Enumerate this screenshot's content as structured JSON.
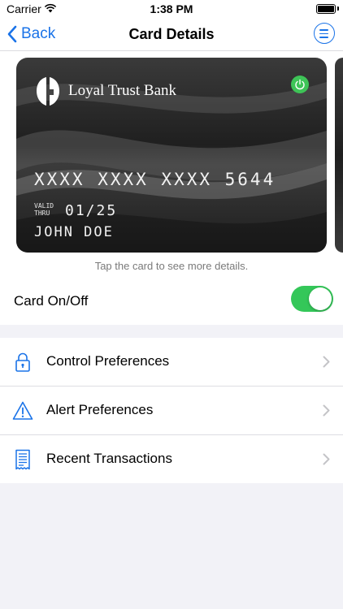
{
  "status_bar": {
    "carrier": "Carrier",
    "time": "1:38 PM"
  },
  "nav": {
    "back_label": "Back",
    "title": "Card Details",
    "menu_icon": "menu-icon",
    "back_icon": "chevron-left-icon"
  },
  "card": {
    "bank_name": "Loyal Trust Bank",
    "number": "XXXX XXXX XXXX 5644",
    "valid_thru_label": [
      "VALID",
      "THRU"
    ],
    "expiry": "01/25",
    "holder": "JOHN DOE",
    "power_icon": "power-icon",
    "power_color": "#3ec457"
  },
  "card_hint": "Tap the card to see more details.",
  "card_toggle": {
    "label": "Card On/Off",
    "on": true,
    "color": "#34c759"
  },
  "list": [
    {
      "label": "Control Preferences",
      "icon": "lock-icon"
    },
    {
      "label": "Alert Preferences",
      "icon": "warning-icon"
    },
    {
      "label": "Recent Transactions",
      "icon": "receipt-icon"
    }
  ],
  "colors": {
    "accent": "#1a73e8",
    "background": "#f2f2f7"
  }
}
